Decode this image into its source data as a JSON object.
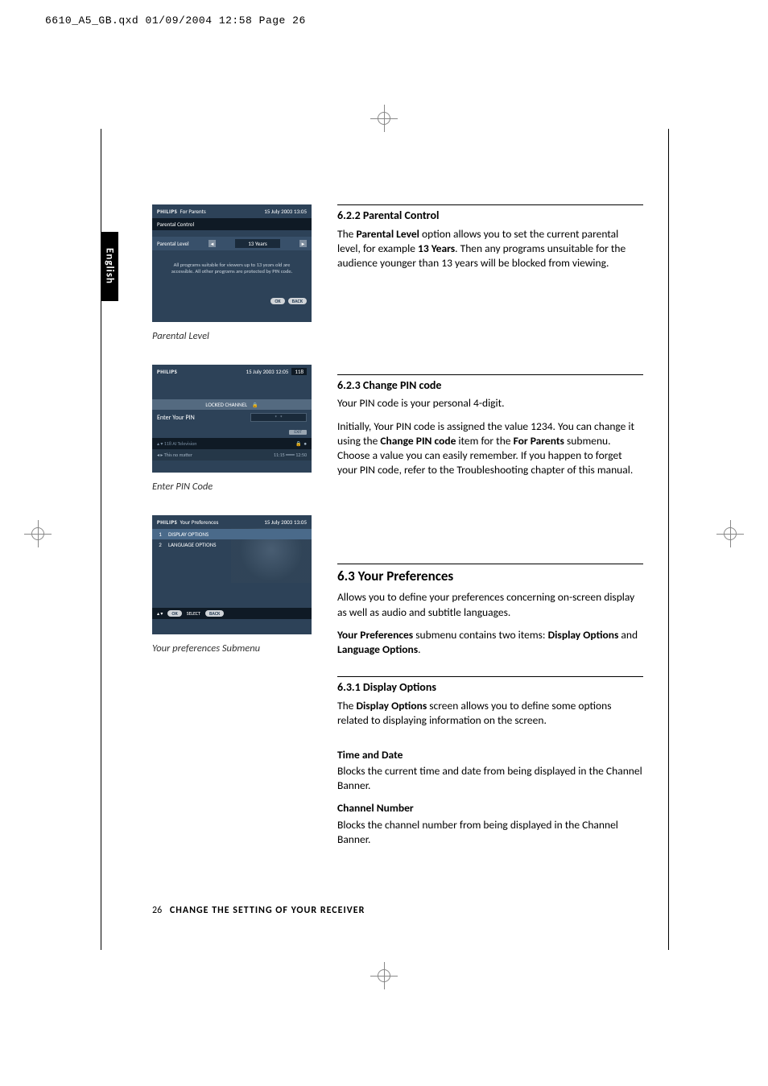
{
  "slug": "6610_A5_GB.qxd  01/09/2004  12:58  Page 26",
  "lang_tab": "English",
  "footer": {
    "page_no": "26",
    "title": "CHANGE THE SETTING OF YOUR RECEIVER"
  },
  "shot1": {
    "brand": "PHILIPS",
    "brand_sub": "For Parents",
    "datetime": "15 July 2003   13:05",
    "menu_title": "Parental Control",
    "row_label": "Parental Level",
    "row_value": "13 Years",
    "note": "All programs suitable for viewers up to 13 years old are accessible.  All other programs are protected by PIN code.",
    "btn_ok": "OK",
    "btn_back": "BACK"
  },
  "caption1": "Parental Level",
  "shot2": {
    "brand": "PHILIPS",
    "datetime": "15 July 2003   12:05",
    "ch_no": "118",
    "locked": "LOCKED CHANNEL",
    "prompt": "Enter Your PIN",
    "exit": "EXIT",
    "bot_ch": "118 AI Television",
    "bot_prog": "This no matter",
    "bot_time": "11:15",
    "bot_end": "12:50"
  },
  "caption2": "Enter PIN Code",
  "shot3": {
    "brand": "PHILIPS",
    "brand_sub": "Your Preferences",
    "datetime": "15 July 2003   13:05",
    "item1_no": "1",
    "item1": "DISPLAY OPTIONS",
    "item2_no": "2",
    "item2": "LANGUAGE OPTIONS",
    "nav_ok": "OK",
    "nav_select": "SELECT",
    "nav_back": "BACK"
  },
  "caption3": "Your preferences Submenu",
  "s622": {
    "head": "6.2.2   Parental Control",
    "p1a": "The ",
    "p1b": "Parental Level",
    "p1c": " option allows you to set the current parental level, for example ",
    "p1d": "13 Years",
    "p1e": ". Then any programs unsuitable for the audience younger than 13 years will be blocked from viewing."
  },
  "s623": {
    "head": "6.2.3   Change PIN code",
    "p1": "Your PIN code is your personal 4-digit.",
    "p2a": "Initially, Your PIN code is assigned the value 1234. You can change it using the ",
    "p2b": "Change PIN code",
    "p2c": " item for the ",
    "p2d": "For Parents",
    "p2e": " submenu. Choose a value you can easily remember. If you happen to forget your PIN code, refer to the Troubleshooting chapter of this manual."
  },
  "s63": {
    "head": "6.3   Your Preferences",
    "p1": "Allows you to define your preferences concerning on-screen display as well as audio and subtitle languages.",
    "p2a": "Your Preferences",
    "p2b": " submenu contains two items: ",
    "p2c": "Display Options",
    "p2d": " and ",
    "p2e": "Language Options",
    "p2f": "."
  },
  "s631": {
    "head": "6.3.1   Display Options",
    "p1a": "The ",
    "p1b": "Display Options",
    "p1c": " screen allows you to define some options related to displaying information on the screen.",
    "td_h": "Time and Date",
    "td_p": "Blocks the current time and date from being displayed in the Channel Banner.",
    "cn_h": "Channel Number",
    "cn_p": "Blocks the channel number from being displayed in the Channel Banner."
  }
}
